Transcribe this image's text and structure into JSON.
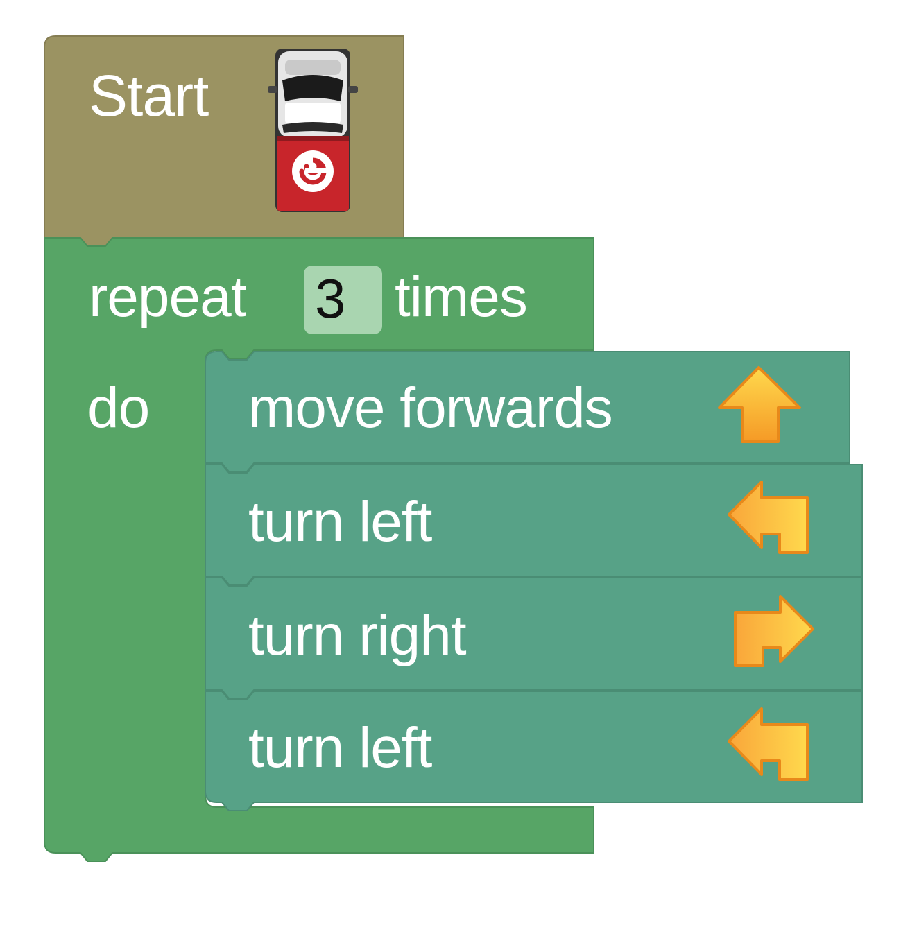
{
  "start_block": {
    "label": "Start",
    "color": "#9b9362",
    "icon": "pickup-truck-icon"
  },
  "repeat_block": {
    "label_before": "repeat",
    "count": "3",
    "label_after": "times",
    "do_label": "do",
    "color": "#57a566",
    "field_color": "#a9d5b0"
  },
  "statements": [
    {
      "label": "move forwards",
      "icon": "arrow-up-icon"
    },
    {
      "label": "turn left",
      "icon": "turn-left-arrow-icon"
    },
    {
      "label": "turn right",
      "icon": "turn-right-arrow-icon"
    },
    {
      "label": "turn left",
      "icon": "turn-left-arrow-icon"
    }
  ],
  "statement_color": "#57a287",
  "arrow_color": "#f7a92f"
}
